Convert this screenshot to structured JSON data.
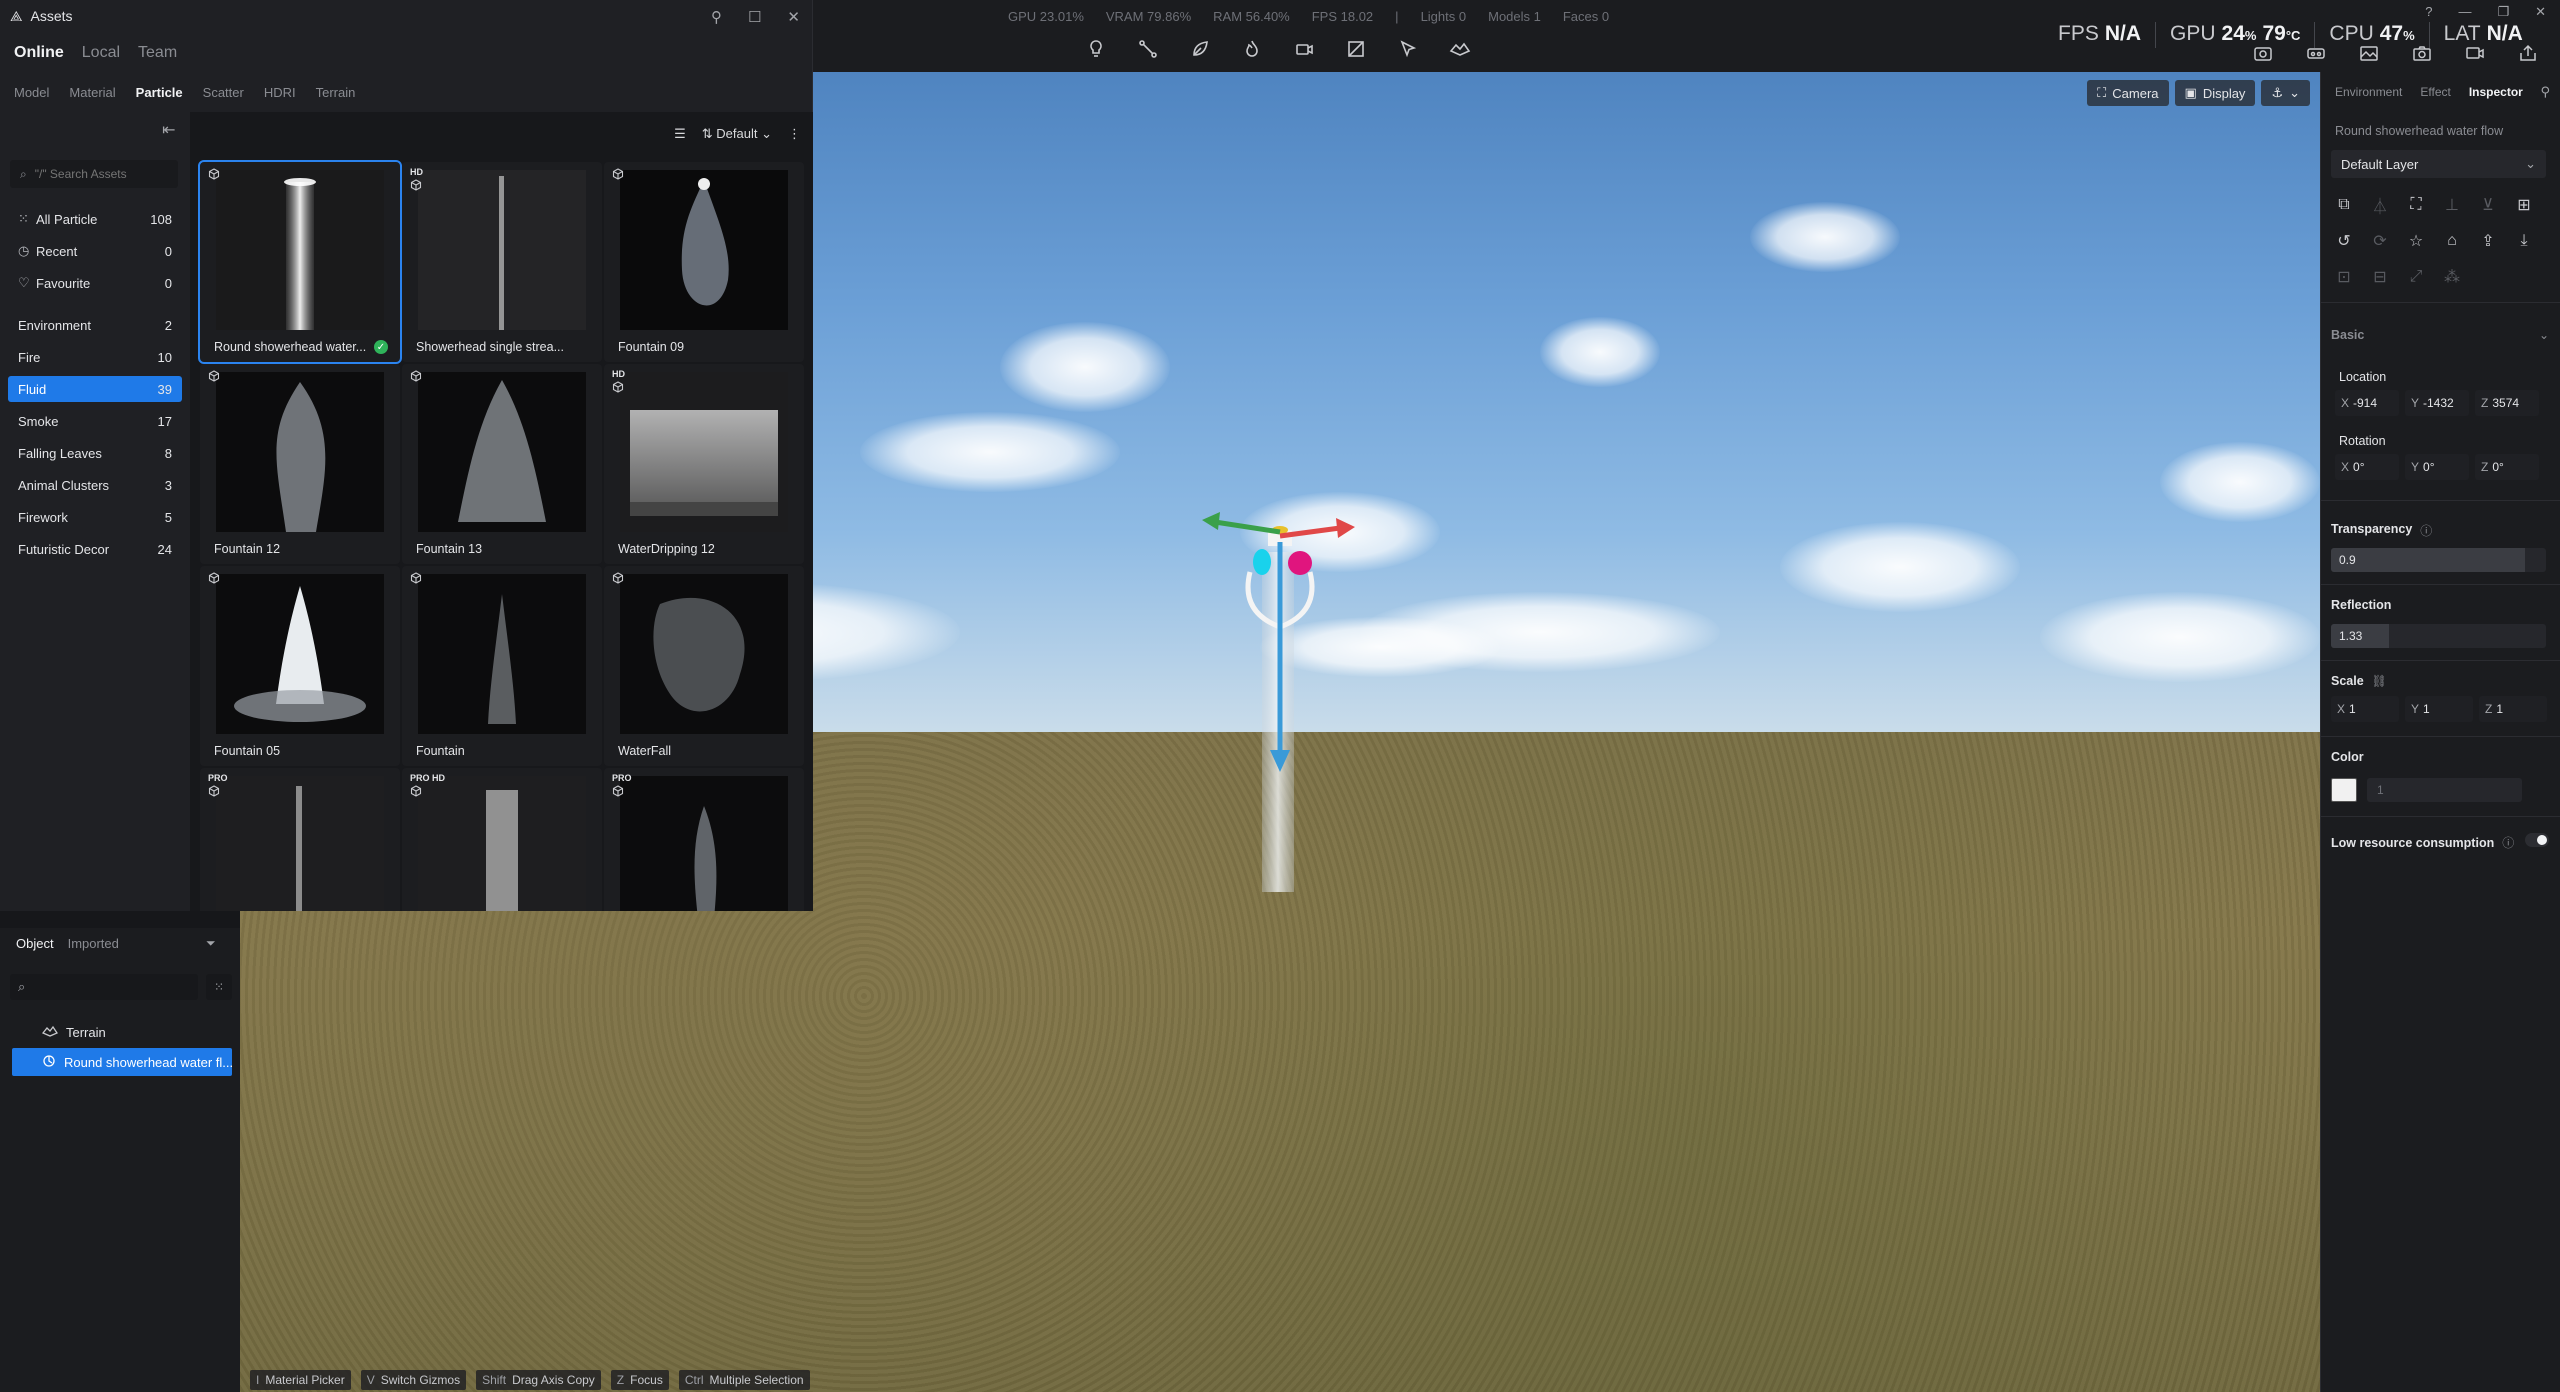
{
  "app": {
    "perf_stats": [
      "GPU 23.01%",
      "VRAM 79.86%",
      "RAM 56.40%",
      "FPS 18.02",
      "|",
      "Lights 0",
      "Models 1",
      "Faces 0"
    ],
    "hw": {
      "fps_label": "FPS",
      "fps_value": "N/A",
      "gpu_label": "GPU",
      "gpu_value": "24",
      "gpu_unit": "%",
      "gpu_temp": "79",
      "gpu_temp_unit": "°C",
      "cpu_label": "CPU",
      "cpu_value": "47",
      "cpu_unit": "%",
      "lat_label": "LAT",
      "lat_value": "N/A"
    },
    "window_controls": [
      "?",
      "—",
      "❐",
      "✕"
    ]
  },
  "toolbar": {
    "icons": [
      "light-bulb-icon",
      "path-icon",
      "leaf-icon",
      "fire-icon",
      "camera-move-icon",
      "measure-icon",
      "cursor-select-icon",
      "terrain-icon"
    ]
  },
  "assets": {
    "title": "Assets",
    "source_tabs": [
      "Online",
      "Local",
      "Team"
    ],
    "active_source": "Online",
    "category_tabs": [
      "Model",
      "Material",
      "Particle",
      "Scatter",
      "HDRI",
      "Terrain"
    ],
    "active_category": "Particle",
    "search_placeholder": "\"/\" Search Assets",
    "quick_items": [
      {
        "label": "All Particle",
        "count": "108",
        "icon": "grid-icon"
      },
      {
        "label": "Recent",
        "count": "0",
        "icon": "clock-icon"
      },
      {
        "label": "Favourite",
        "count": "0",
        "icon": "heart-icon"
      }
    ],
    "categories": [
      {
        "label": "Environment",
        "count": "2"
      },
      {
        "label": "Fire",
        "count": "10"
      },
      {
        "label": "Fluid",
        "count": "39",
        "selected": true
      },
      {
        "label": "Smoke",
        "count": "17"
      },
      {
        "label": "Falling Leaves",
        "count": "8"
      },
      {
        "label": "Animal Clusters",
        "count": "3"
      },
      {
        "label": "Firework",
        "count": "5"
      },
      {
        "label": "Futuristic Decor",
        "count": "24"
      }
    ],
    "sort_label": "Default",
    "items": [
      {
        "label": "Round showerhead water...",
        "badge": "",
        "selected": true,
        "downloaded": true
      },
      {
        "label": "Showerhead single strea...",
        "badge": "HD"
      },
      {
        "label": "Fountain 09",
        "badge": ""
      },
      {
        "label": "Fountain 12",
        "badge": ""
      },
      {
        "label": "Fountain 13",
        "badge": ""
      },
      {
        "label": "WaterDripping 12",
        "badge": "HD"
      },
      {
        "label": "Fountain 05",
        "badge": ""
      },
      {
        "label": "Fountain",
        "badge": ""
      },
      {
        "label": "WaterFall",
        "badge": ""
      },
      {
        "label": "",
        "badge": "PRO"
      },
      {
        "label": "",
        "badge": "PRO HD"
      },
      {
        "label": "",
        "badge": "PRO"
      }
    ]
  },
  "objects": {
    "tabs": [
      "Object",
      "Imported"
    ],
    "active_tab": "Object",
    "tree": [
      {
        "label": "Terrain",
        "icon": "terrain-icon"
      },
      {
        "label": "Round showerhead water fl...",
        "icon": "particle-icon",
        "selected": true
      }
    ]
  },
  "viewport": {
    "buttons": [
      {
        "label": "Camera",
        "icon": "camera-icon"
      },
      {
        "label": "Display",
        "icon": "display-icon"
      }
    ],
    "shortcuts": [
      {
        "key": "I",
        "label": "Material Picker"
      },
      {
        "key": "V",
        "label": "Switch Gizmos"
      },
      {
        "key": "Shift",
        "label": "Drag Axis Copy"
      },
      {
        "key": "Z",
        "label": "Focus"
      },
      {
        "key": "Ctrl",
        "label": "Multiple Selection"
      }
    ]
  },
  "inspector": {
    "tabs": [
      "Environment",
      "Effect",
      "Inspector"
    ],
    "active_tab": "Inspector",
    "object_name": "Round showerhead water flow",
    "layer": "Default Layer",
    "basic_label": "Basic",
    "location_label": "Location",
    "location": {
      "x": "-914",
      "y": "-1432",
      "z": "3574"
    },
    "rotation_label": "Rotation",
    "rotation": {
      "x": "0°",
      "y": "0°",
      "z": "0°"
    },
    "transparency_label": "Transparency",
    "transparency": "0.9",
    "transparency_fraction": 0.9,
    "reflection_label": "Reflection",
    "reflection": "1.33",
    "reflection_fraction": 0.27,
    "scale_label": "Scale",
    "scale": {
      "x": "1",
      "y": "1",
      "z": "1"
    },
    "color_label": "Color",
    "color_value": "1",
    "color_hex": "#f1f1f1",
    "low_resource_label": "Low resource consumption"
  },
  "colors": {
    "accent": "#1f7ae8",
    "gizmo_x": "#e04848",
    "gizmo_y": "#3aa04a",
    "gizmo_z": "#3a9ad8"
  }
}
